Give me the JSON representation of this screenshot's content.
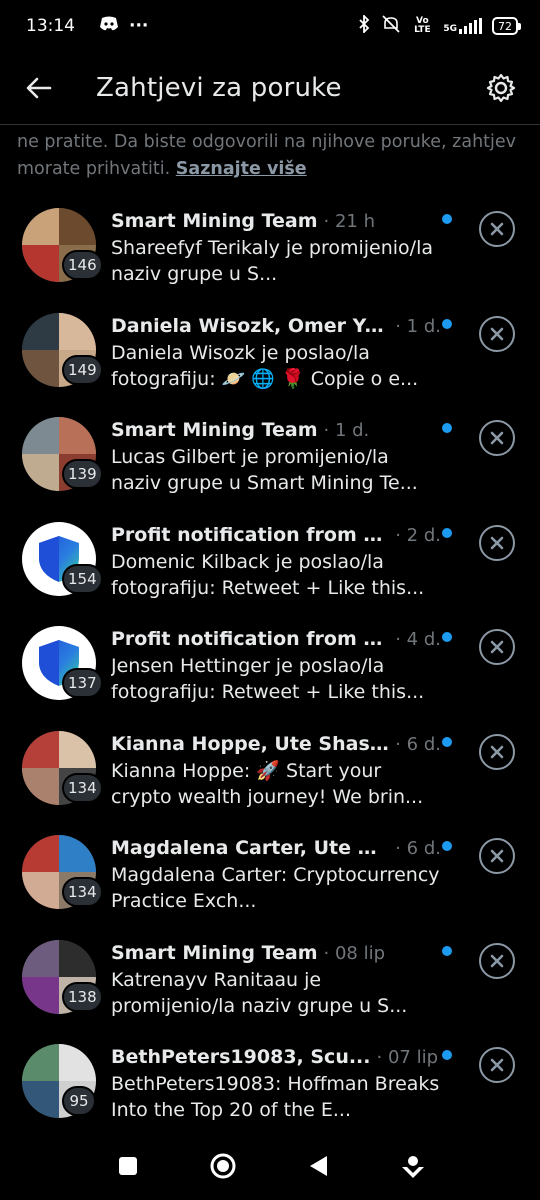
{
  "status_bar": {
    "time": "13:14",
    "more": "···",
    "network": "5G",
    "volte": "Vo LTE",
    "battery": "72"
  },
  "app_bar": {
    "title": "Zahtjevi za poruke"
  },
  "notice": {
    "text": "ne pratite. Da biste odgovorili na njihove poruke, zahtjev morate prihvatiti.",
    "link": "Saznajte više"
  },
  "requests": [
    {
      "name": "Smart Mining Team",
      "time": "· 21 h",
      "message": "Shareefyf Terikaly je promijenio/la naziv grupe u S...",
      "count": "146",
      "avatar": "group-photo"
    },
    {
      "name": "Daniela Wisozk, Omer Yo...",
      "time": "· 1 d.",
      "message": "Daniela Wisozk je poslao/la fotografiju: 🪐 🌐 🌹 Copie o e...",
      "count": "149",
      "avatar": "group-photo"
    },
    {
      "name": "Smart Mining Team",
      "time": "· 1 d.",
      "message": "Lucas Gilbert je promijenio/la naziv grupe u Smart Mining Te...",
      "count": "139",
      "avatar": "group-photo"
    },
    {
      "name": "Profit notification from U...",
      "time": "· 2 d.",
      "message": "Domenic Kilback je poslao/la fotografiju: Retweet + Like this...",
      "count": "154",
      "avatar": "shield"
    },
    {
      "name": "Profit notification from U...",
      "time": "· 4 d.",
      "message": "Jensen Hettinger je poslao/la fotografiju: Retweet + Like this...",
      "count": "137",
      "avatar": "shield"
    },
    {
      "name": "Kianna Hoppe, Ute Shast...",
      "time": "· 6 d.",
      "message": "Kianna Hoppe: 🚀 Start your crypto wealth journey! We brin...",
      "count": "134",
      "avatar": "group-photo"
    },
    {
      "name": "Magdalena Carter, Ute S...",
      "time": "· 6 d.",
      "message": "Magdalena Carter: Cryptocurrency Practice Exch...",
      "count": "134",
      "avatar": "group-photo"
    },
    {
      "name": "Smart Mining Team",
      "time": "· 08 lip",
      "message": "Katrenayv Ranitaau je promijenio/la naziv grupe u S...",
      "count": "138",
      "avatar": "group-photo"
    },
    {
      "name": "BethPeters19083, Scu...",
      "time": "· 07 lip",
      "message": "BethPeters19083: Hoffman Breaks Into the Top 20 of the E...",
      "count": "95",
      "avatar": "group-photo"
    }
  ],
  "colors": {
    "accent": "#1d9bf0",
    "background": "#000000",
    "muted": "#71767b"
  }
}
